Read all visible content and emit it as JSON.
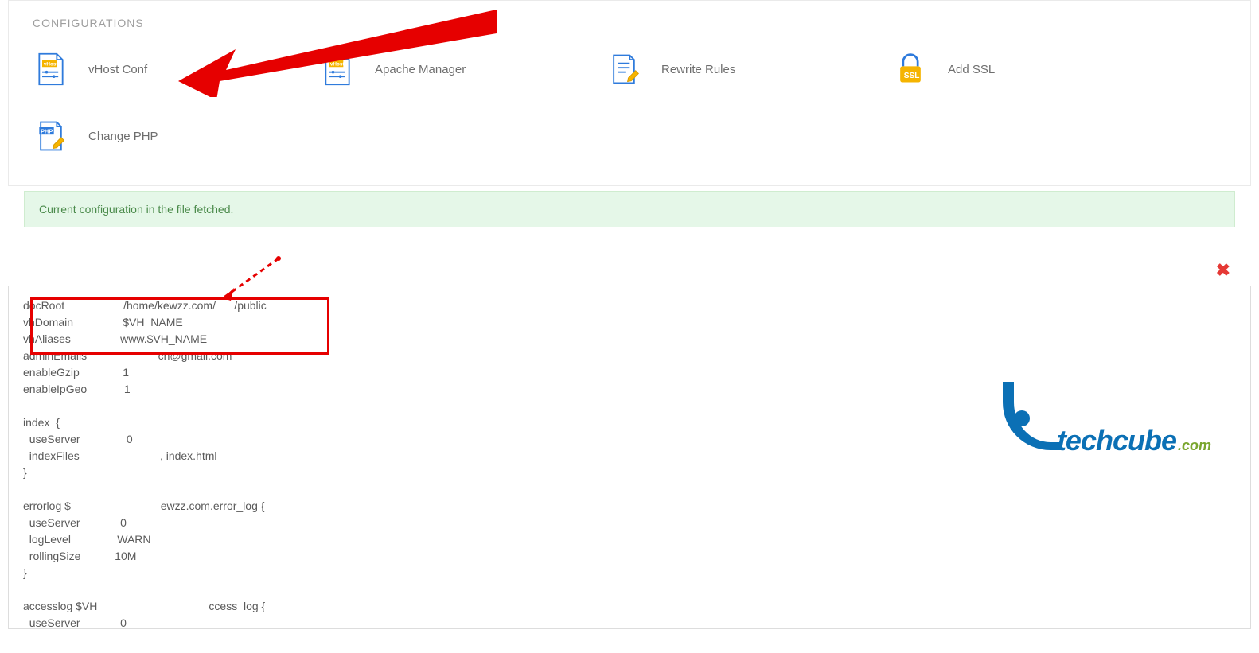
{
  "section_title": "CONFIGURATIONS",
  "tiles": {
    "vhost_conf": "vHost Conf",
    "apache_manager": "Apache Manager",
    "rewrite_rules": "Rewrite Rules",
    "add_ssl": "Add SSL",
    "change_php": "Change PHP"
  },
  "alert_message": "Current configuration in the file fetched.",
  "close_symbol": "✖",
  "editor_text": "docRoot                   /home/kewzz.com/      /public\nvhDomain                $VH_NAME\nvhAliases                www.$VH_NAME\nadminEmails                       ch@gmail.com\nenableGzip              1\nenableIpGeo            1\n\nindex  {\n  useServer               0\n  indexFiles                          , index.html\n}\n\nerrorlog $                             ewzz.com.error_log {\n  useServer             0\n  logLevel               WARN\n  rollingSize           10M\n}\n\naccesslog $VH                                    ccess_log {\n  useServer             0",
  "watermark": {
    "brand": "techcube",
    "tld": ".com"
  }
}
